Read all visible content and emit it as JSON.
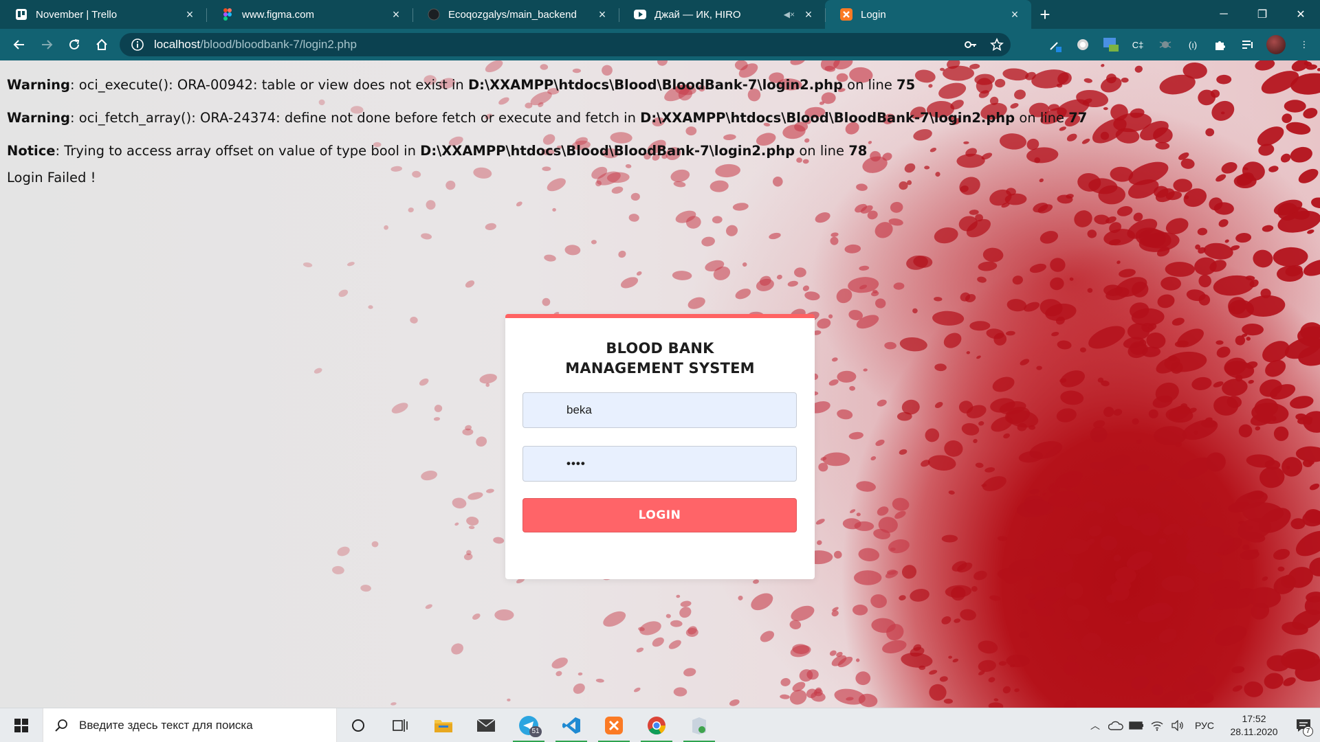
{
  "browser": {
    "tabs": [
      {
        "title": "November | Trello",
        "icon": "trello-icon"
      },
      {
        "title": "www.figma.com",
        "icon": "figma-icon"
      },
      {
        "title": "Ecoqozgalys/main_backend",
        "icon": "github-icon"
      },
      {
        "title": "Джай — ИК, HIRO",
        "icon": "youtube-icon"
      },
      {
        "title": "Login",
        "icon": "xampp-icon"
      }
    ],
    "active_tab": 4,
    "url_host": "localhost",
    "url_path": "/blood/bloodbank-7/login2.php"
  },
  "page": {
    "messages": [
      {
        "level": "Warning",
        "text": ": oci_execute(): ORA-00942: table or view does not exist in ",
        "file": "D:\\XXAMPP\\htdocs\\Blood\\BloodBank-7\\login2.php",
        "on_line": " on line ",
        "line": "75"
      },
      {
        "level": "Warning",
        "text": ": oci_fetch_array(): ORA-24374: define not done before fetch or execute and fetch in ",
        "file": "D:\\XXAMPP\\htdocs\\Blood\\BloodBank-7\\login2.php",
        "on_line": " on line ",
        "line": "77"
      },
      {
        "level": "Notice",
        "text": ": Trying to access array offset on value of type bool in ",
        "file": "D:\\XXAMPP\\htdocs\\Blood\\BloodBank-7\\login2.php",
        "on_line": " on line ",
        "line": "78"
      }
    ],
    "status": "Login Failed !",
    "login": {
      "title_line1": "BLOOD BANK",
      "title_line2": "MANAGEMENT SYSTEM",
      "username_value": "beka",
      "password_value": "••••",
      "button_label": "LOGIN"
    }
  },
  "taskbar": {
    "search_placeholder": "Введите здесь текст для поиска",
    "telegram_badge": "51",
    "language": "РУС",
    "time": "17:52",
    "date": "28.11.2020",
    "notifications": "7"
  },
  "colors": {
    "accent": "#ff6262",
    "chrome_dark": "#0d4a57",
    "chrome": "#126272",
    "field_bg": "#e8f0fe"
  }
}
